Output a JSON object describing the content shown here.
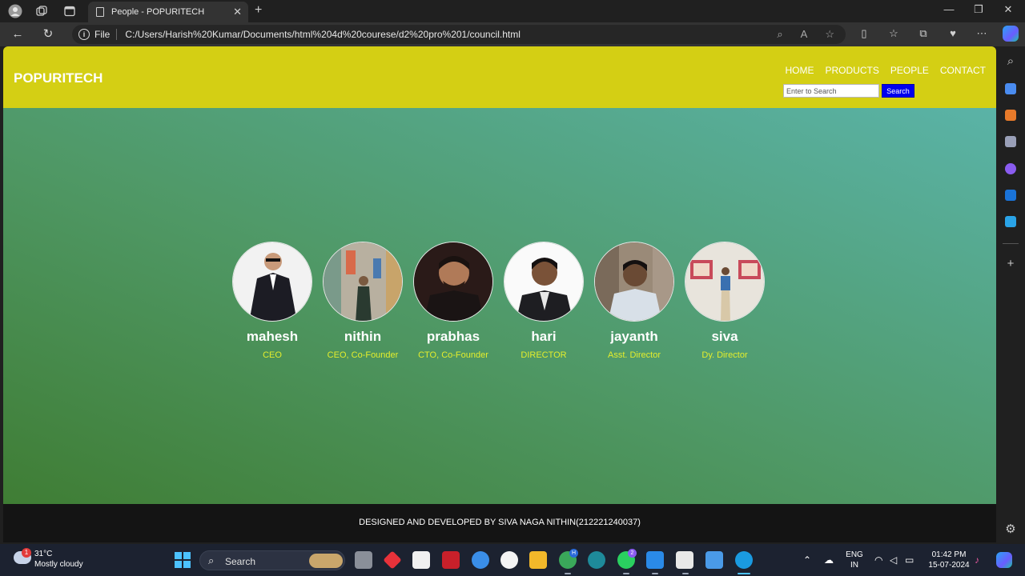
{
  "browser": {
    "tab_title": "People - POPURITECH",
    "new_tab": "+",
    "address": {
      "protocol_label": "File",
      "url": "C:/Users/Harish%20Kumar/Documents/html%204d%20courese/d2%20pro%201/council.html"
    }
  },
  "site": {
    "logo": "POPURITECH",
    "nav": [
      "HOME",
      "PRODUCTS",
      "PEOPLE",
      "CONTACT"
    ],
    "search": {
      "placeholder": "Enter to Search",
      "button": "Search"
    },
    "people": [
      {
        "name": "mahesh",
        "role": "CEO"
      },
      {
        "name": "nithin",
        "role": "CEO, Co-Founder"
      },
      {
        "name": "prabhas",
        "role": "CTO, Co-Founder"
      },
      {
        "name": "hari",
        "role": "DIRECTOR"
      },
      {
        "name": "jayanth",
        "role": "Asst. Director"
      },
      {
        "name": "siva",
        "role": "Dy. Director"
      }
    ],
    "footer": "DESIGNED AND DEVELOPED BY SIVA NAGA NITHIN(212221240037)"
  },
  "colors": {
    "header": "#d4cf14",
    "role_text": "#e3ee2d",
    "search_button": "#0000ee",
    "footer": "#141414"
  },
  "taskbar": {
    "weather": {
      "temp": "31°C",
      "desc": "Mostly cloudy",
      "badge": "1"
    },
    "search_label": "Search",
    "language": {
      "line1": "ENG",
      "line2": "IN"
    },
    "clock": {
      "time": "01:42 PM",
      "date": "15-07-2024"
    },
    "badges": {
      "outlook": "H",
      "whatsapp": "2"
    }
  }
}
